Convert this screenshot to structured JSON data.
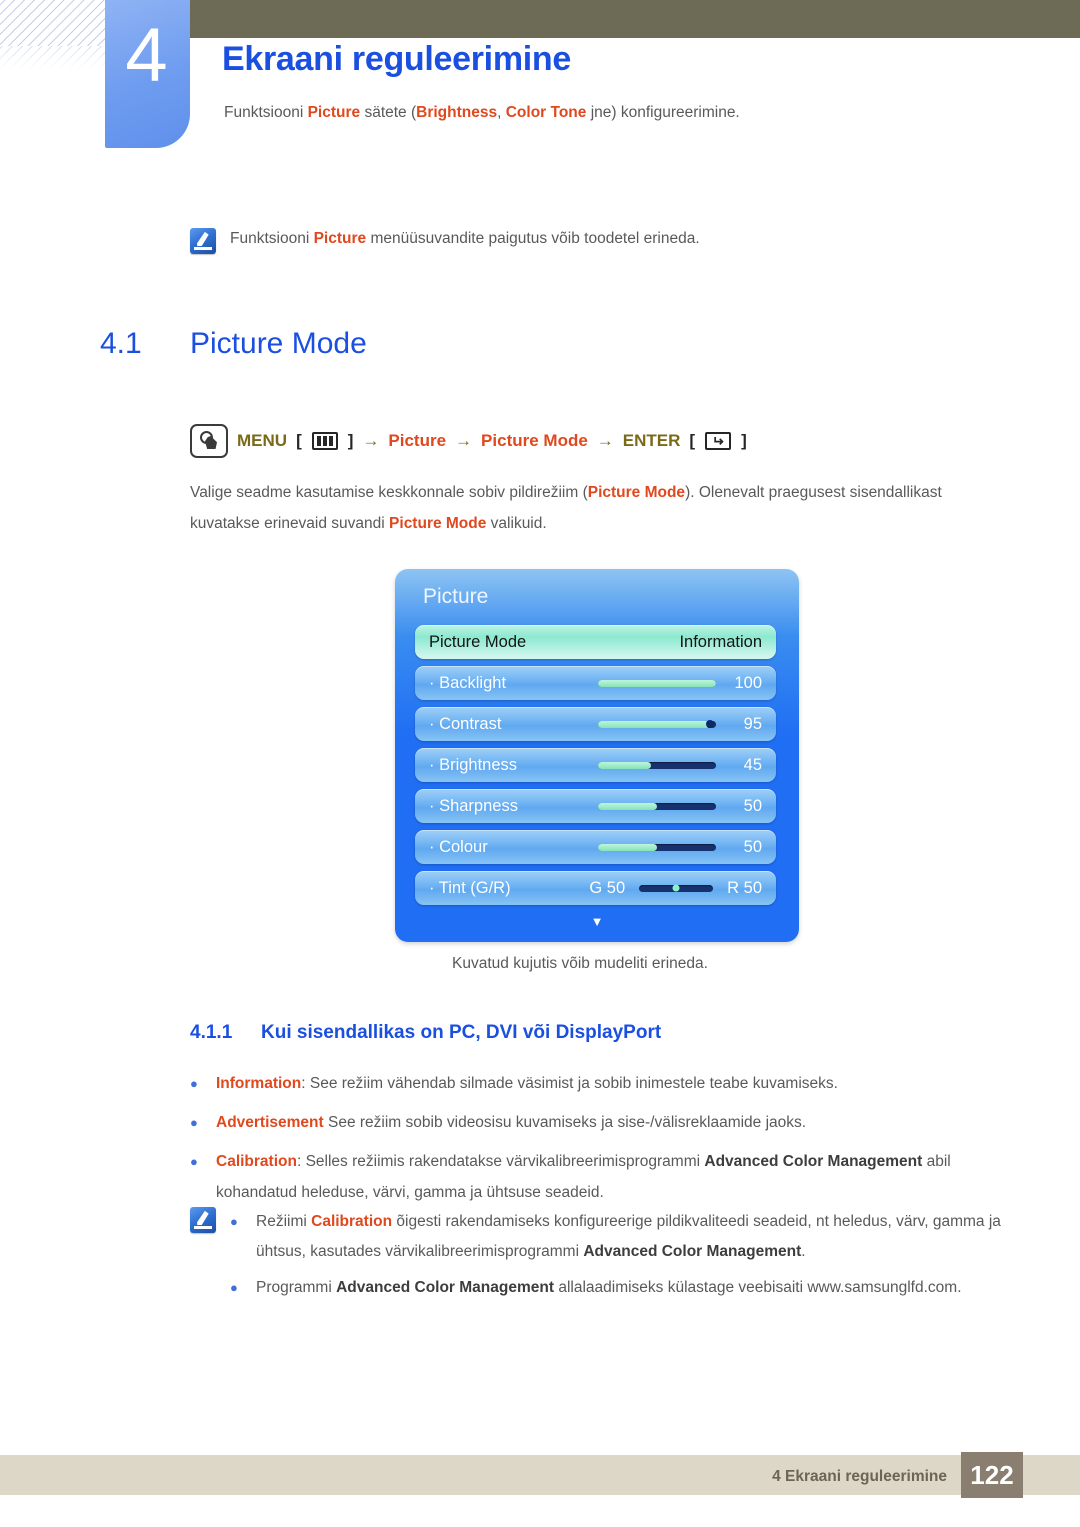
{
  "chapter": {
    "number": "4",
    "title": "Ekraani reguleerimine",
    "description_parts": [
      {
        "t": "Funktsiooni ",
        "s": "plain"
      },
      {
        "t": "Picture",
        "s": "kw"
      },
      {
        "t": " sätete (",
        "s": "plain"
      },
      {
        "t": "Brightness",
        "s": "kw"
      },
      {
        "t": ", ",
        "s": "plain"
      },
      {
        "t": "Color Tone",
        "s": "kw"
      },
      {
        "t": " jne) konfigureerimine.",
        "s": "plain"
      }
    ],
    "description_plain": "Funktsiooni Picture sätete (Brightness, Color Tone jne) konfigureerimine."
  },
  "note_top": {
    "icon": "note-icon",
    "text_parts": [
      {
        "t": "Funktsiooni ",
        "s": "plain"
      },
      {
        "t": "Picture",
        "s": "kw"
      },
      {
        "t": " menüüsuvandite paigutus võib toodetel erineda.",
        "s": "plain"
      }
    ],
    "text_plain": "Funktsiooni Picture menüüsuvandite paigutus võib toodetel erineda."
  },
  "section": {
    "number": "4.1",
    "name": "Picture Mode"
  },
  "menu_path": {
    "icon": "hand-press-icon",
    "menu_label": "MENU",
    "menu_key_icon": "menu-key-icon",
    "arrow": "→",
    "step1": "Picture",
    "step2": "Picture Mode",
    "enter_label": "ENTER",
    "enter_key_icon": "enter-key-icon",
    "bracket_open": "[",
    "bracket_close": "]"
  },
  "body_paragraph": {
    "parts": [
      {
        "t": "Valige seadme kasutamise keskkonnale sobiv pildirežiim (",
        "s": "plain"
      },
      {
        "t": "Picture Mode",
        "s": "kw"
      },
      {
        "t": "). Olenevalt praegusest sisendallikast kuvatakse erinevaid suvandi ",
        "s": "plain"
      },
      {
        "t": "Picture Mode",
        "s": "kw"
      },
      {
        "t": " valikuid.",
        "s": "plain"
      }
    ],
    "plain": "Valige seadme kasutamise keskkonnale sobiv pildirežiim (Picture Mode). Olenevalt praegusest sisendallikast kuvatakse erinevaid suvandi Picture Mode valikuid."
  },
  "osd": {
    "title": "Picture",
    "caret_icon": "chevron-down-icon",
    "rows": [
      {
        "label": "Picture Mode",
        "value": "Information",
        "type": "select",
        "selected": true
      },
      {
        "label": "· Backlight",
        "value": "100",
        "type": "slider",
        "fill_percent": 100,
        "knob": false
      },
      {
        "label": "· Contrast",
        "value": "95",
        "type": "slider",
        "fill_percent": 95,
        "knob": true
      },
      {
        "label": "· Brightness",
        "value": "45",
        "type": "slider",
        "fill_percent": 45,
        "knob": false
      },
      {
        "label": "· Sharpness",
        "value": "50",
        "type": "slider",
        "fill_percent": 50,
        "knob": false
      },
      {
        "label": "· Colour",
        "value": "50",
        "type": "slider",
        "fill_percent": 50,
        "knob": false
      },
      {
        "label": "· Tint (G/R)",
        "left_value": "G 50",
        "right_value": "R 50",
        "type": "tint"
      }
    ]
  },
  "caption": "Kuvatud kujutis võib mudeliti erineda.",
  "subsection": {
    "number": "4.1.1",
    "name": "Kui sisendallikas on PC, DVI või DisplayPort"
  },
  "bullets": [
    {
      "parts": [
        {
          "t": "Information",
          "s": "kw"
        },
        {
          "t": ": See režiim vähendab silmade väsimist ja sobib inimestele teabe kuvamiseks.",
          "s": "plain"
        }
      ],
      "plain": "Information: See režiim vähendab silmade väsimist ja sobib inimestele teabe kuvamiseks."
    },
    {
      "parts": [
        {
          "t": "Advertisement",
          "s": "kw"
        },
        {
          "t": " See režiim sobib videosisu kuvamiseks ja sise-/välisreklaamide jaoks.",
          "s": "plain"
        }
      ],
      "plain": "Advertisement See režiim sobib videosisu kuvamiseks ja sise-/välisreklaamide jaoks."
    },
    {
      "parts": [
        {
          "t": "Calibration",
          "s": "kw"
        },
        {
          "t": ": Selles režiimis rakendatakse värvikalibreerimisprogrammi ",
          "s": "plain"
        },
        {
          "t": "Advanced Color Management",
          "s": "bold"
        },
        {
          "t": " abil kohandatud heleduse, värvi, gamma ja ühtsuse seadeid.",
          "s": "plain"
        }
      ],
      "plain": "Calibration: Selles režiimis rakendatakse värvikalibreerimisprogrammi Advanced Color Management abil kohandatud heleduse, värvi, gamma ja ühtsuse seadeid."
    }
  ],
  "note_bottom": {
    "icon": "note-icon",
    "bullets": [
      {
        "parts": [
          {
            "t": "Režiimi ",
            "s": "plain"
          },
          {
            "t": "Calibration",
            "s": "kw"
          },
          {
            "t": " õigesti rakendamiseks konfigureerige pildikvaliteedi seadeid, nt heledus, värv, gamma ja ühtsus, kasutades värvikalibreerimisprogrammi ",
            "s": "plain"
          },
          {
            "t": "Advanced Color Management",
            "s": "bold"
          },
          {
            "t": ".",
            "s": "plain"
          }
        ],
        "plain": "Režiimi Calibration õigesti rakendamiseks konfigureerige pildikvaliteedi seadeid, nt heledus, värv, gamma ja ühtsus, kasutades värvikalibreerimisprogrammi Advanced Color Management."
      },
      {
        "parts": [
          {
            "t": "Programmi ",
            "s": "plain"
          },
          {
            "t": "Advanced Color Management",
            "s": "bold"
          },
          {
            "t": " allalaadimiseks külastage veebisaiti www.samsunglfd.com.",
            "s": "plain"
          }
        ],
        "plain": "Programmi Advanced Color Management allalaadimiseks külastage veebisaiti www.samsunglfd.com."
      }
    ]
  },
  "footer": {
    "text": "4 Ekraani reguleerimine",
    "page": "122"
  },
  "colors": {
    "heading_blue": "#1a4fe0",
    "keyword_orange": "#e0481e",
    "olive_band": "#6d6b56",
    "menu_olive": "#7a6a18",
    "footer_band": "#dcd7c6",
    "page_badge": "#8a7e71",
    "body_gray": "#58595b",
    "osd_blue": "#1f6ef4",
    "osd_selected_green": "#8ce9cf"
  }
}
